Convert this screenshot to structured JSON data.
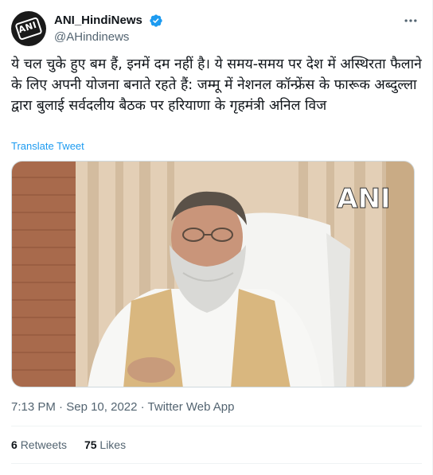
{
  "account": {
    "display_name": "ANI_HindiNews",
    "handle": "@AHindinews",
    "avatar_text": "ANI"
  },
  "tweet": {
    "text": "ये चल चुके हुए बम हैं, इनमें दम नहीं है। ये समय-समय पर देश में अस्थिरता फैलाने के लिए अपनी योजना बनाते रहते हैं: जम्मू में नेशनल कॉन्फ्रेंस के फारूक अब्दुल्ला द्वारा बुलाई सर्वदलीय बैठक पर हरियाणा के गृहमंत्री अनिल विज",
    "translate_label": "Translate Tweet",
    "media_watermark": "ANI"
  },
  "meta": {
    "time": "7:13 PM",
    "separator": "·",
    "date": "Sep 10, 2022",
    "source": "Twitter Web App"
  },
  "stats": {
    "retweets_count": "6",
    "retweets_label": "Retweets",
    "likes_count": "75",
    "likes_label": "Likes"
  },
  "icons": {
    "verified": "verified-badge-icon",
    "more": "more-options-icon"
  },
  "colors": {
    "accent": "#1d9bf0",
    "secondary_text": "#536471",
    "primary_text": "#0f1419"
  }
}
